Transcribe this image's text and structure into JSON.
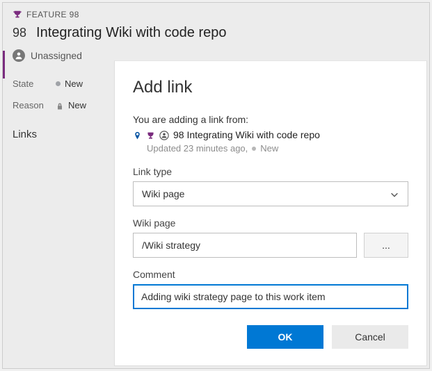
{
  "header": {
    "feature_label": "FEATURE 98",
    "id": "98",
    "title": "Integrating Wiki with code repo",
    "unassigned": "Unassigned"
  },
  "meta": {
    "state_label": "State",
    "state_value": "New",
    "reason_label": "Reason",
    "reason_value": "New"
  },
  "tabs": {
    "links": "Links"
  },
  "dialog": {
    "title": "Add link",
    "adding_from": "You are adding a link from:",
    "from_item": "98 Integrating Wiki with code repo",
    "updated": "Updated 23 minutes ago,",
    "updated_state": "New",
    "link_type_label": "Link type",
    "link_type_value": "Wiki page",
    "wiki_page_label": "Wiki page",
    "wiki_page_value": "/Wiki strategy",
    "browse": "...",
    "comment_label": "Comment",
    "comment_value": "Adding wiki strategy page to this work item",
    "ok": "OK",
    "cancel": "Cancel"
  },
  "colors": {
    "accent": "#7a2b7e",
    "primary": "#0078d4"
  }
}
